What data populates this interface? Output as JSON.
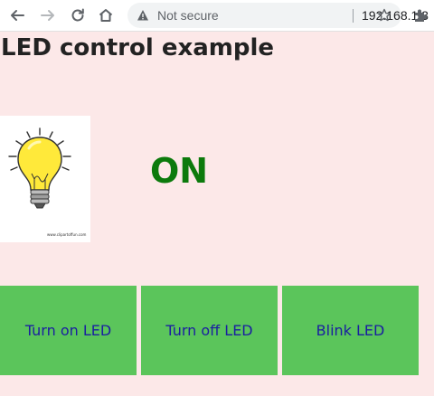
{
  "browser": {
    "security_label": "Not secure",
    "url": "192.168.1.3",
    "icons": [
      "back-arrow-icon",
      "forward-arrow-icon",
      "reload-icon",
      "home-icon",
      "warning-icon",
      "star-icon",
      "puzzle-icon"
    ]
  },
  "page": {
    "title": "LED control example",
    "status": "ON",
    "status_color": "#0c7a0c",
    "image_caption": "www.clipartoffun.com",
    "buttons": {
      "turn_on": "Turn on LED",
      "turn_off": "Turn off LED",
      "blink": "Blink LED"
    }
  },
  "colors": {
    "background": "#fce8e8",
    "button": "#5bc55b",
    "button_text": "#1a1fa0"
  }
}
